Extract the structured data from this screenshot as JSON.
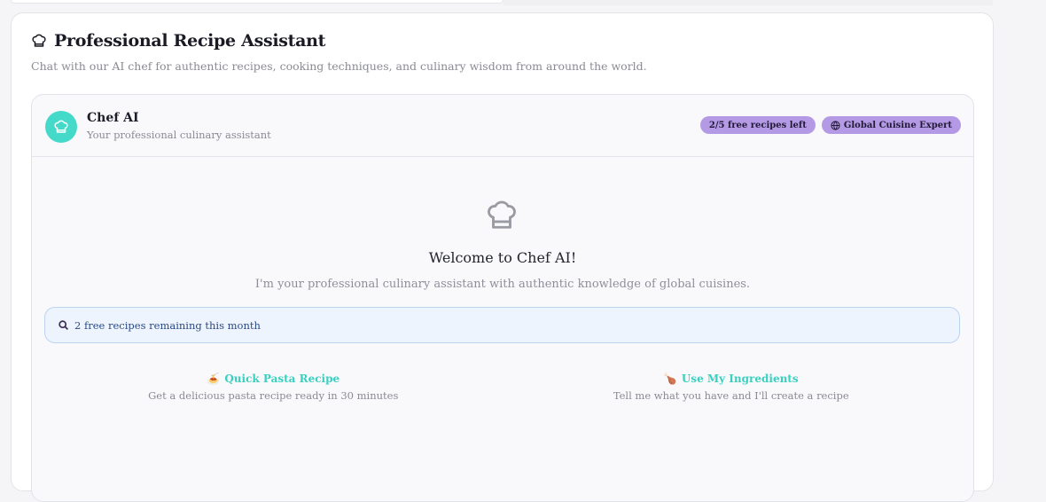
{
  "page": {
    "title": "Professional Recipe Assistant",
    "subtitle": "Chat with our AI chef for authentic recipes, cooking techniques, and culinary wisdom from around the world."
  },
  "chat": {
    "assistant_name": "Chef AI",
    "assistant_tagline": "Your professional culinary assistant",
    "badges": {
      "free_recipes": "2/5 free recipes left",
      "expertise": "Global Cuisine Expert"
    },
    "welcome": {
      "title": "Welcome to Chef AI!",
      "subtitle": "I'm your professional culinary assistant with authentic knowledge of global cuisines."
    },
    "notice": {
      "text": "2 free recipes remaining this month",
      "icon": "search-icon"
    },
    "suggestions": [
      {
        "emoji": "🍝",
        "title": "Quick Pasta Recipe",
        "description": "Get a delicious pasta recipe ready in 30 minutes"
      },
      {
        "emoji": "🍗",
        "title": "Use My Ingredients",
        "description": "Tell me what you have and I'll create a recipe"
      }
    ]
  },
  "colors": {
    "accent": "#44d9c9",
    "badge": "#b49ae4",
    "notice_bg": "#eef4fd"
  }
}
